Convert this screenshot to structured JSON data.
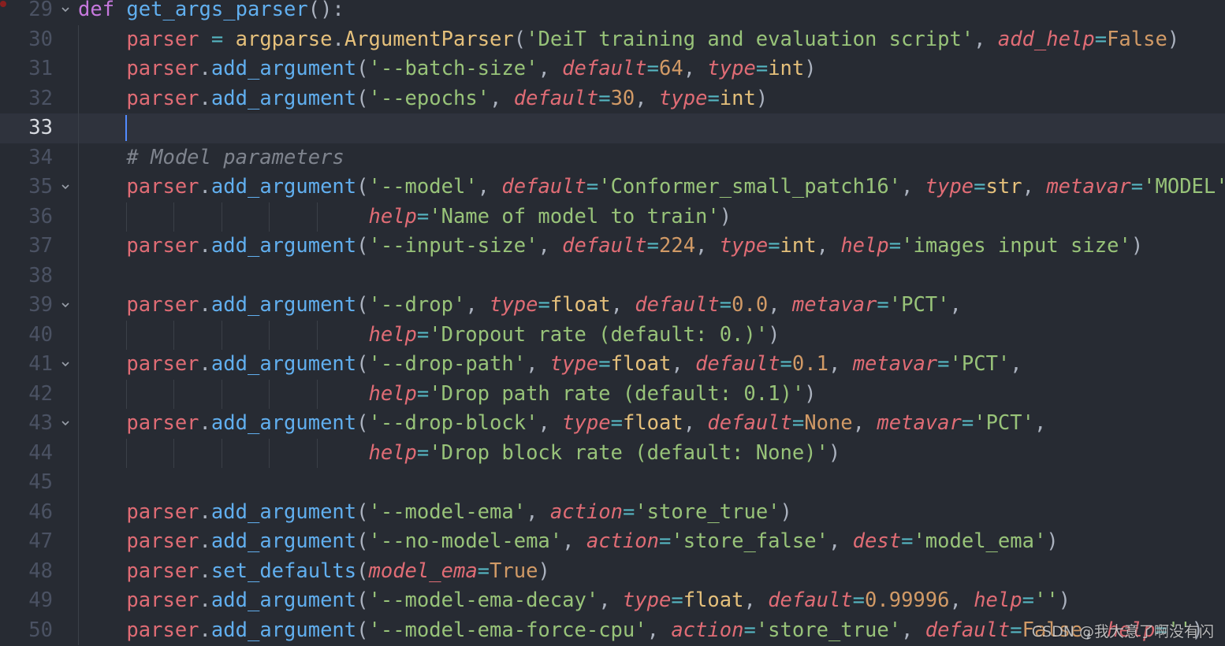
{
  "editor": {
    "current_line": "33",
    "lines": [
      {
        "n": "29",
        "fold": true,
        "indent": 0,
        "tokens": [
          [
            "kw",
            "def"
          ],
          [
            "pun",
            " "
          ],
          [
            "fn",
            "get_args_parser"
          ],
          [
            "pun",
            "():"
          ]
        ]
      },
      {
        "n": "30",
        "indent": 1,
        "tokens": [
          [
            "var",
            "parser"
          ],
          [
            "pun",
            " "
          ],
          [
            "op",
            "="
          ],
          [
            "pun",
            " "
          ],
          [
            "type",
            "argparse"
          ],
          [
            "pun",
            "."
          ],
          [
            "cls",
            "ArgumentParser"
          ],
          [
            "pun",
            "("
          ],
          [
            "str",
            "'DeiT training and evaluation script'"
          ],
          [
            "pun",
            ", "
          ],
          [
            "param",
            "add_help"
          ],
          [
            "op",
            "="
          ],
          [
            "num",
            "False"
          ],
          [
            "pun",
            ")"
          ]
        ]
      },
      {
        "n": "31",
        "indent": 1,
        "tokens": [
          [
            "var",
            "parser"
          ],
          [
            "pun",
            "."
          ],
          [
            "fn",
            "add_argument"
          ],
          [
            "pun",
            "("
          ],
          [
            "str",
            "'--batch-size'"
          ],
          [
            "pun",
            ", "
          ],
          [
            "param",
            "default"
          ],
          [
            "op",
            "="
          ],
          [
            "num",
            "64"
          ],
          [
            "pun",
            ", "
          ],
          [
            "param",
            "type"
          ],
          [
            "op",
            "="
          ],
          [
            "type",
            "int"
          ],
          [
            "pun",
            ")"
          ]
        ]
      },
      {
        "n": "32",
        "indent": 1,
        "tokens": [
          [
            "var",
            "parser"
          ],
          [
            "pun",
            "."
          ],
          [
            "fn",
            "add_argument"
          ],
          [
            "pun",
            "("
          ],
          [
            "str",
            "'--epochs'"
          ],
          [
            "pun",
            ", "
          ],
          [
            "param",
            "default"
          ],
          [
            "op",
            "="
          ],
          [
            "num",
            "30"
          ],
          [
            "pun",
            ", "
          ],
          [
            "param",
            "type"
          ],
          [
            "op",
            "="
          ],
          [
            "type",
            "int"
          ],
          [
            "pun",
            ")"
          ]
        ]
      },
      {
        "n": "33",
        "indent": 1,
        "current": true,
        "cursor": true,
        "tokens": []
      },
      {
        "n": "34",
        "indent": 1,
        "tokens": [
          [
            "cmt",
            "# Model parameters"
          ]
        ]
      },
      {
        "n": "35",
        "fold": true,
        "indent": 1,
        "tokens": [
          [
            "var",
            "parser"
          ],
          [
            "pun",
            "."
          ],
          [
            "fn",
            "add_argument"
          ],
          [
            "pun",
            "("
          ],
          [
            "str",
            "'--model'"
          ],
          [
            "pun",
            ", "
          ],
          [
            "param",
            "default"
          ],
          [
            "op",
            "="
          ],
          [
            "str",
            "'Conformer_small_patch16'"
          ],
          [
            "pun",
            ", "
          ],
          [
            "param",
            "type"
          ],
          [
            "op",
            "="
          ],
          [
            "type",
            "str"
          ],
          [
            "pun",
            ", "
          ],
          [
            "param",
            "metavar"
          ],
          [
            "op",
            "="
          ],
          [
            "str",
            "'MODEL'"
          ],
          [
            "pun",
            ","
          ]
        ]
      },
      {
        "n": "36",
        "indent": 6,
        "tokens": [
          [
            "param",
            "help"
          ],
          [
            "op",
            "="
          ],
          [
            "str",
            "'Name of model to train'"
          ],
          [
            "pun",
            ")"
          ]
        ]
      },
      {
        "n": "37",
        "indent": 1,
        "tokens": [
          [
            "var",
            "parser"
          ],
          [
            "pun",
            "."
          ],
          [
            "fn",
            "add_argument"
          ],
          [
            "pun",
            "("
          ],
          [
            "str",
            "'--input-size'"
          ],
          [
            "pun",
            ", "
          ],
          [
            "param",
            "default"
          ],
          [
            "op",
            "="
          ],
          [
            "num",
            "224"
          ],
          [
            "pun",
            ", "
          ],
          [
            "param",
            "type"
          ],
          [
            "op",
            "="
          ],
          [
            "type",
            "int"
          ],
          [
            "pun",
            ", "
          ],
          [
            "param",
            "help"
          ],
          [
            "op",
            "="
          ],
          [
            "str",
            "'images input size'"
          ],
          [
            "pun",
            ")"
          ]
        ]
      },
      {
        "n": "38",
        "indent": 0,
        "tokens": []
      },
      {
        "n": "39",
        "fold": true,
        "indent": 1,
        "tokens": [
          [
            "var",
            "parser"
          ],
          [
            "pun",
            "."
          ],
          [
            "fn",
            "add_argument"
          ],
          [
            "pun",
            "("
          ],
          [
            "str",
            "'--drop'"
          ],
          [
            "pun",
            ", "
          ],
          [
            "param",
            "type"
          ],
          [
            "op",
            "="
          ],
          [
            "type",
            "float"
          ],
          [
            "pun",
            ", "
          ],
          [
            "param",
            "default"
          ],
          [
            "op",
            "="
          ],
          [
            "num",
            "0.0"
          ],
          [
            "pun",
            ", "
          ],
          [
            "param",
            "metavar"
          ],
          [
            "op",
            "="
          ],
          [
            "str",
            "'PCT'"
          ],
          [
            "pun",
            ","
          ]
        ]
      },
      {
        "n": "40",
        "indent": 6,
        "tokens": [
          [
            "param",
            "help"
          ],
          [
            "op",
            "="
          ],
          [
            "str",
            "'Dropout rate (default: 0.)'"
          ],
          [
            "pun",
            ")"
          ]
        ]
      },
      {
        "n": "41",
        "fold": true,
        "indent": 1,
        "tokens": [
          [
            "var",
            "parser"
          ],
          [
            "pun",
            "."
          ],
          [
            "fn",
            "add_argument"
          ],
          [
            "pun",
            "("
          ],
          [
            "str",
            "'--drop-path'"
          ],
          [
            "pun",
            ", "
          ],
          [
            "param",
            "type"
          ],
          [
            "op",
            "="
          ],
          [
            "type",
            "float"
          ],
          [
            "pun",
            ", "
          ],
          [
            "param",
            "default"
          ],
          [
            "op",
            "="
          ],
          [
            "num",
            "0.1"
          ],
          [
            "pun",
            ", "
          ],
          [
            "param",
            "metavar"
          ],
          [
            "op",
            "="
          ],
          [
            "str",
            "'PCT'"
          ],
          [
            "pun",
            ","
          ]
        ]
      },
      {
        "n": "42",
        "indent": 6,
        "tokens": [
          [
            "param",
            "help"
          ],
          [
            "op",
            "="
          ],
          [
            "str",
            "'Drop path rate (default: 0.1)'"
          ],
          [
            "pun",
            ")"
          ]
        ]
      },
      {
        "n": "43",
        "fold": true,
        "indent": 1,
        "tokens": [
          [
            "var",
            "parser"
          ],
          [
            "pun",
            "."
          ],
          [
            "fn",
            "add_argument"
          ],
          [
            "pun",
            "("
          ],
          [
            "str",
            "'--drop-block'"
          ],
          [
            "pun",
            ", "
          ],
          [
            "param",
            "type"
          ],
          [
            "op",
            "="
          ],
          [
            "type",
            "float"
          ],
          [
            "pun",
            ", "
          ],
          [
            "param",
            "default"
          ],
          [
            "op",
            "="
          ],
          [
            "num",
            "None"
          ],
          [
            "pun",
            ", "
          ],
          [
            "param",
            "metavar"
          ],
          [
            "op",
            "="
          ],
          [
            "str",
            "'PCT'"
          ],
          [
            "pun",
            ","
          ]
        ]
      },
      {
        "n": "44",
        "indent": 6,
        "tokens": [
          [
            "param",
            "help"
          ],
          [
            "op",
            "="
          ],
          [
            "str",
            "'Drop block rate (default: None)'"
          ],
          [
            "pun",
            ")"
          ]
        ]
      },
      {
        "n": "45",
        "indent": 0,
        "tokens": []
      },
      {
        "n": "46",
        "indent": 1,
        "tokens": [
          [
            "var",
            "parser"
          ],
          [
            "pun",
            "."
          ],
          [
            "fn",
            "add_argument"
          ],
          [
            "pun",
            "("
          ],
          [
            "str",
            "'--model-ema'"
          ],
          [
            "pun",
            ", "
          ],
          [
            "param",
            "action"
          ],
          [
            "op",
            "="
          ],
          [
            "str",
            "'store_true'"
          ],
          [
            "pun",
            ")"
          ]
        ]
      },
      {
        "n": "47",
        "indent": 1,
        "tokens": [
          [
            "var",
            "parser"
          ],
          [
            "pun",
            "."
          ],
          [
            "fn",
            "add_argument"
          ],
          [
            "pun",
            "("
          ],
          [
            "str",
            "'--no-model-ema'"
          ],
          [
            "pun",
            ", "
          ],
          [
            "param",
            "action"
          ],
          [
            "op",
            "="
          ],
          [
            "str",
            "'store_false'"
          ],
          [
            "pun",
            ", "
          ],
          [
            "param",
            "dest"
          ],
          [
            "op",
            "="
          ],
          [
            "str",
            "'model_ema'"
          ],
          [
            "pun",
            ")"
          ]
        ]
      },
      {
        "n": "48",
        "indent": 1,
        "tokens": [
          [
            "var",
            "parser"
          ],
          [
            "pun",
            "."
          ],
          [
            "fn",
            "set_defaults"
          ],
          [
            "pun",
            "("
          ],
          [
            "param",
            "model_ema"
          ],
          [
            "op",
            "="
          ],
          [
            "num",
            "True"
          ],
          [
            "pun",
            ")"
          ]
        ]
      },
      {
        "n": "49",
        "indent": 1,
        "tokens": [
          [
            "var",
            "parser"
          ],
          [
            "pun",
            "."
          ],
          [
            "fn",
            "add_argument"
          ],
          [
            "pun",
            "("
          ],
          [
            "str",
            "'--model-ema-decay'"
          ],
          [
            "pun",
            ", "
          ],
          [
            "param",
            "type"
          ],
          [
            "op",
            "="
          ],
          [
            "type",
            "float"
          ],
          [
            "pun",
            ", "
          ],
          [
            "param",
            "default"
          ],
          [
            "op",
            "="
          ],
          [
            "num",
            "0.99996"
          ],
          [
            "pun",
            ", "
          ],
          [
            "param",
            "help"
          ],
          [
            "op",
            "="
          ],
          [
            "str",
            "''"
          ],
          [
            "pun",
            ")"
          ]
        ]
      },
      {
        "n": "50",
        "indent": 1,
        "tokens": [
          [
            "var",
            "parser"
          ],
          [
            "pun",
            "."
          ],
          [
            "fn",
            "add_argument"
          ],
          [
            "pun",
            "("
          ],
          [
            "str",
            "'--model-ema-force-cpu'"
          ],
          [
            "pun",
            ", "
          ],
          [
            "param",
            "action"
          ],
          [
            "op",
            "="
          ],
          [
            "str",
            "'store_true'"
          ],
          [
            "pun",
            ", "
          ],
          [
            "param",
            "default"
          ],
          [
            "op",
            "="
          ],
          [
            "num",
            "False"
          ],
          [
            "pun",
            ", "
          ],
          [
            "param",
            "help"
          ],
          [
            "op",
            "="
          ],
          [
            "str",
            "''"
          ],
          [
            "pun",
            ")"
          ]
        ]
      }
    ]
  },
  "watermark": "CSDN @我大意了啊没有闪",
  "icons": {
    "fold": "chevron-down-icon",
    "breakpoint": "breakpoint-dot-icon"
  },
  "colors": {
    "background": "#272b33",
    "current_line": "#2f333d",
    "keyword": "#c678dd",
    "function": "#61afef",
    "variable": "#e06c75",
    "string": "#98c379",
    "number": "#d19a66",
    "type": "#e5c07b",
    "comment": "#7f848e",
    "cursor": "#528bff"
  }
}
